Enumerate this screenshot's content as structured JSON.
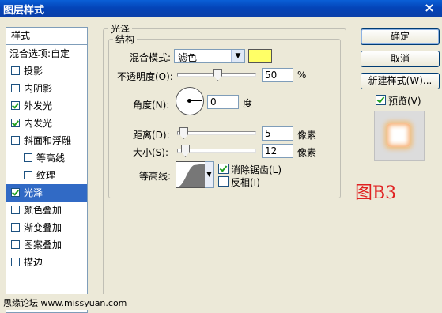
{
  "window": {
    "title": "图层样式",
    "close_glyph": "×"
  },
  "styles_panel": {
    "header": "样式",
    "blend_options": "混合选项:自定",
    "items": [
      {
        "label": "投影",
        "checked": false,
        "indent": false
      },
      {
        "label": "内阴影",
        "checked": false,
        "indent": false
      },
      {
        "label": "外发光",
        "checked": true,
        "indent": false
      },
      {
        "label": "内发光",
        "checked": true,
        "indent": false
      },
      {
        "label": "斜面和浮雕",
        "checked": false,
        "indent": false
      },
      {
        "label": "等高线",
        "checked": false,
        "indent": true
      },
      {
        "label": "纹理",
        "checked": false,
        "indent": true
      },
      {
        "label": "光泽",
        "checked": true,
        "indent": false,
        "selected": true
      },
      {
        "label": "颜色叠加",
        "checked": false,
        "indent": false
      },
      {
        "label": "渐变叠加",
        "checked": false,
        "indent": false
      },
      {
        "label": "图案叠加",
        "checked": false,
        "indent": false
      },
      {
        "label": "描边",
        "checked": false,
        "indent": false
      }
    ]
  },
  "satin": {
    "title": "光泽",
    "structure_title": "结构",
    "blend_mode_label": "混合模式:",
    "blend_mode_value": "滤色",
    "color": "#ffff66",
    "opacity_label": "不透明度(O):",
    "opacity_value": "50",
    "opacity_unit": "%",
    "opacity_fraction": 0.5,
    "angle_label": "角度(N):",
    "angle_value": "0",
    "angle_unit": "度",
    "distance_label": "距离(D):",
    "distance_value": "5",
    "distance_unit": "像素",
    "distance_fraction": 0.02,
    "size_label": "大小(S):",
    "size_value": "12",
    "size_unit": "像素",
    "size_fraction": 0.05,
    "contour_label": "等高线:",
    "antialias_label": "消除锯齿(L)",
    "antialias_checked": true,
    "invert_label": "反相(I)",
    "invert_checked": false
  },
  "buttons": {
    "ok": "确定",
    "cancel": "取消",
    "new_style": "新建样式(W)...",
    "preview": "预览(V)",
    "preview_checked": true
  },
  "annotation": "图B3",
  "footer": "思缘论坛 www.missyuan.com"
}
